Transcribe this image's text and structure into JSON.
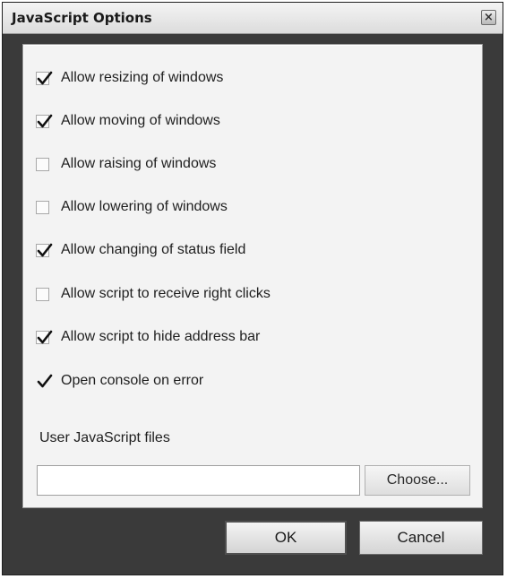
{
  "window": {
    "title": "JavaScript Options",
    "close_symbol": "×"
  },
  "options": [
    {
      "label": "Allow resizing of windows",
      "checked": true,
      "boxed": true
    },
    {
      "label": "Allow moving of windows",
      "checked": true,
      "boxed": true
    },
    {
      "label": "Allow raising of windows",
      "checked": false,
      "boxed": true
    },
    {
      "label": "Allow lowering of windows",
      "checked": false,
      "boxed": true
    },
    {
      "label": "Allow changing of status field",
      "checked": true,
      "boxed": true
    },
    {
      "label": "Allow script to receive right clicks",
      "checked": false,
      "boxed": true
    },
    {
      "label": "Allow script to hide address bar",
      "checked": true,
      "boxed": true
    },
    {
      "label": "Open console on error",
      "checked": true,
      "boxed": false
    }
  ],
  "user_files": {
    "label": "User JavaScript files",
    "value": "",
    "choose_label": "Choose..."
  },
  "buttons": {
    "ok_label": "OK",
    "cancel_label": "Cancel"
  }
}
